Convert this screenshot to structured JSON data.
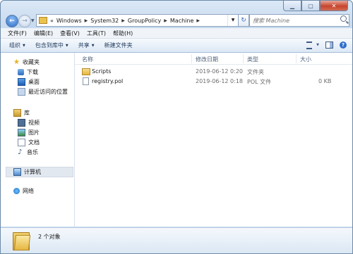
{
  "window": {
    "caption_buttons": [
      "minimize-icon",
      "maximize-icon",
      "close-icon"
    ]
  },
  "address_bar": {
    "prefix": "«",
    "breadcrumbs": [
      "Windows",
      "System32",
      "GroupPolicy",
      "Machine"
    ],
    "search_placeholder": "搜索 Machine"
  },
  "menu": [
    "文件(F)",
    "编辑(E)",
    "查看(V)",
    "工具(T)",
    "帮助(H)"
  ],
  "toolbar": {
    "organize": "组织",
    "include_in_library": "包含到库中",
    "share": "共享",
    "new_folder": "新建文件夹"
  },
  "nav": {
    "favorites": "收藏夹",
    "downloads": "下载",
    "desktop": "桌面",
    "recent": "最近访问的位置",
    "libraries": "库",
    "videos": "视频",
    "pictures": "图片",
    "documents": "文档",
    "music": "音乐",
    "computer": "计算机",
    "network": "网络"
  },
  "columns": {
    "name": "名称",
    "modified": "修改日期",
    "type": "类型",
    "size": "大小"
  },
  "files": [
    {
      "name": "Scripts",
      "modified": "2019-06-12 0:20",
      "type": "文件夹",
      "size": "",
      "icon": "folder-icon"
    },
    {
      "name": "registry.pol",
      "modified": "2019-06-12 0:18",
      "type": "POL 文件",
      "size": "0 KB",
      "icon": "file-icon"
    }
  ],
  "details": {
    "status": "2 个对象"
  },
  "colors": {
    "frame": "#c6d9ee",
    "close_button": "#c7452e",
    "folder": "#e3b53f"
  }
}
